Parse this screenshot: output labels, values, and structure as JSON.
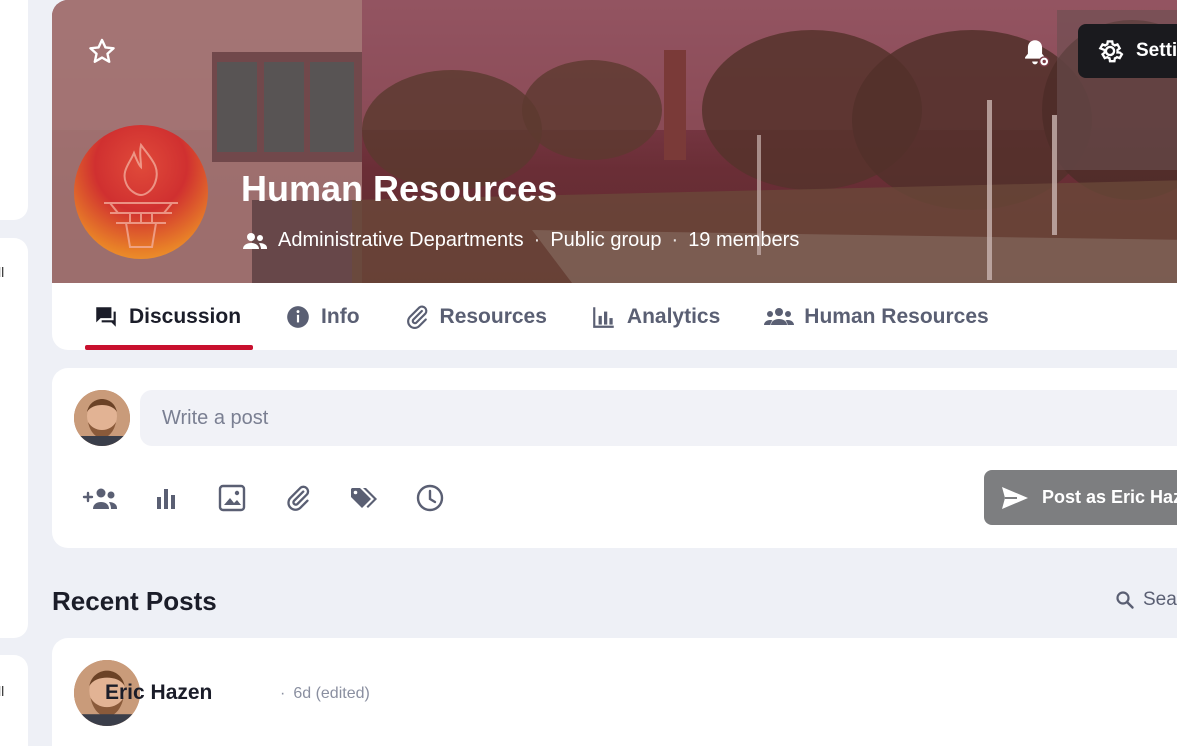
{
  "left_rail": {
    "fragment_1": "ll",
    "fragment_2": "ll"
  },
  "header": {
    "star_icon": "star-outline-icon",
    "bell_icon": "bell-settings-icon",
    "settings_label": "Settings",
    "group_title": "Human Resources",
    "category": "Administrative Departments",
    "privacy": "Public group",
    "members": "19 members",
    "separator": "·"
  },
  "tabs": [
    {
      "label": "Discussion",
      "icon": "chat-icon",
      "active": true
    },
    {
      "label": "Info",
      "icon": "info-icon",
      "active": false
    },
    {
      "label": "Resources",
      "icon": "paperclip-icon",
      "active": false
    },
    {
      "label": "Analytics",
      "icon": "bar-chart-icon",
      "active": false
    },
    {
      "label": "Human Resources",
      "icon": "people-icon",
      "active": false
    }
  ],
  "composer": {
    "placeholder": "Write a post",
    "tools": [
      "add-people-icon",
      "poll-icon",
      "image-icon",
      "attachment-icon",
      "tag-icon",
      "schedule-icon"
    ],
    "post_button": "Post as Eric Hazen"
  },
  "feed": {
    "title": "Recent Posts",
    "search_label": "Search"
  },
  "post": {
    "author": "Eric Hazen",
    "separator": "·",
    "time": "6d (edited)"
  },
  "colors": {
    "accent": "#c8102e",
    "background": "#eef0f6",
    "post_button": "#7d7e80",
    "settings_button": "#1a1a1e"
  }
}
